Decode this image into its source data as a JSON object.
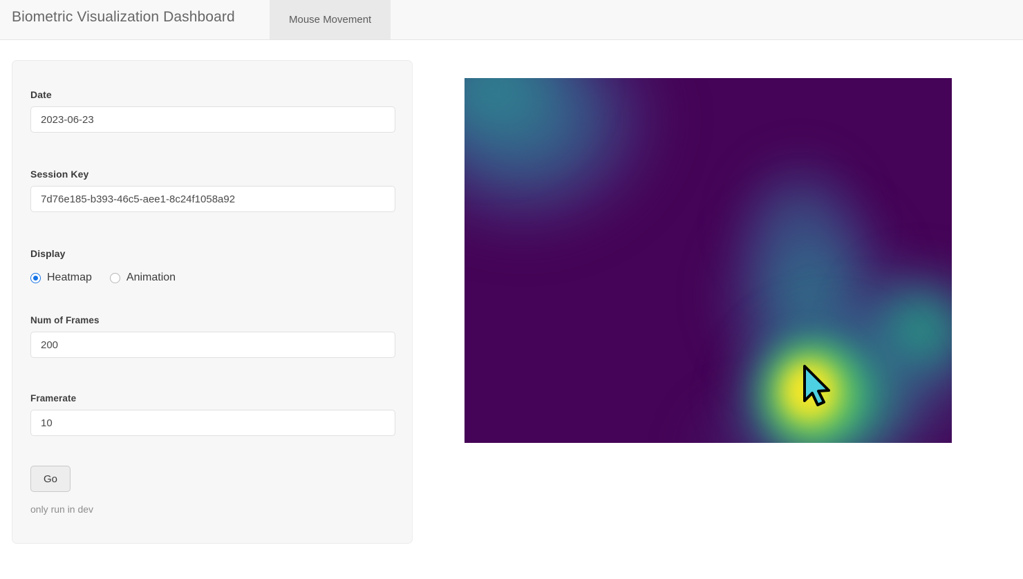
{
  "header": {
    "title": "Biometric Visualization Dashboard",
    "tabs": [
      {
        "label": "Mouse Movement",
        "active": true
      }
    ]
  },
  "panel": {
    "date": {
      "label": "Date",
      "value": "2023-06-23",
      "placeholder": "2023-06-23"
    },
    "session_key": {
      "label": "Session Key",
      "value": "7d76e185-b393-46c5-aee1-8c24f1058a92",
      "placeholder": "7d76e185-b393-46c5-aee1-8c24f1058a92"
    },
    "display": {
      "label": "Display",
      "selected": "Heatmap",
      "options": [
        {
          "label": "Heatmap",
          "checked": true
        },
        {
          "label": "Animation",
          "checked": false
        }
      ]
    },
    "num_of_frames": {
      "label": "Num of Frames",
      "value": "200",
      "placeholder": "200"
    },
    "framerate": {
      "label": "Framerate",
      "value": "10",
      "placeholder": "10"
    },
    "submit": {
      "label": "Go"
    },
    "note": "only run in dev"
  },
  "visualization": {
    "type": "heatmap",
    "colormap": "viridis",
    "cursor": "mouse-pointer",
    "colors": {
      "background": "#450457",
      "low": "#450457",
      "mid_blue": "#31788e",
      "mid_green": "#2ba081",
      "high": "#fde725",
      "cursor_fill": "#4dd0e1",
      "cursor_outline": "#000000"
    }
  }
}
